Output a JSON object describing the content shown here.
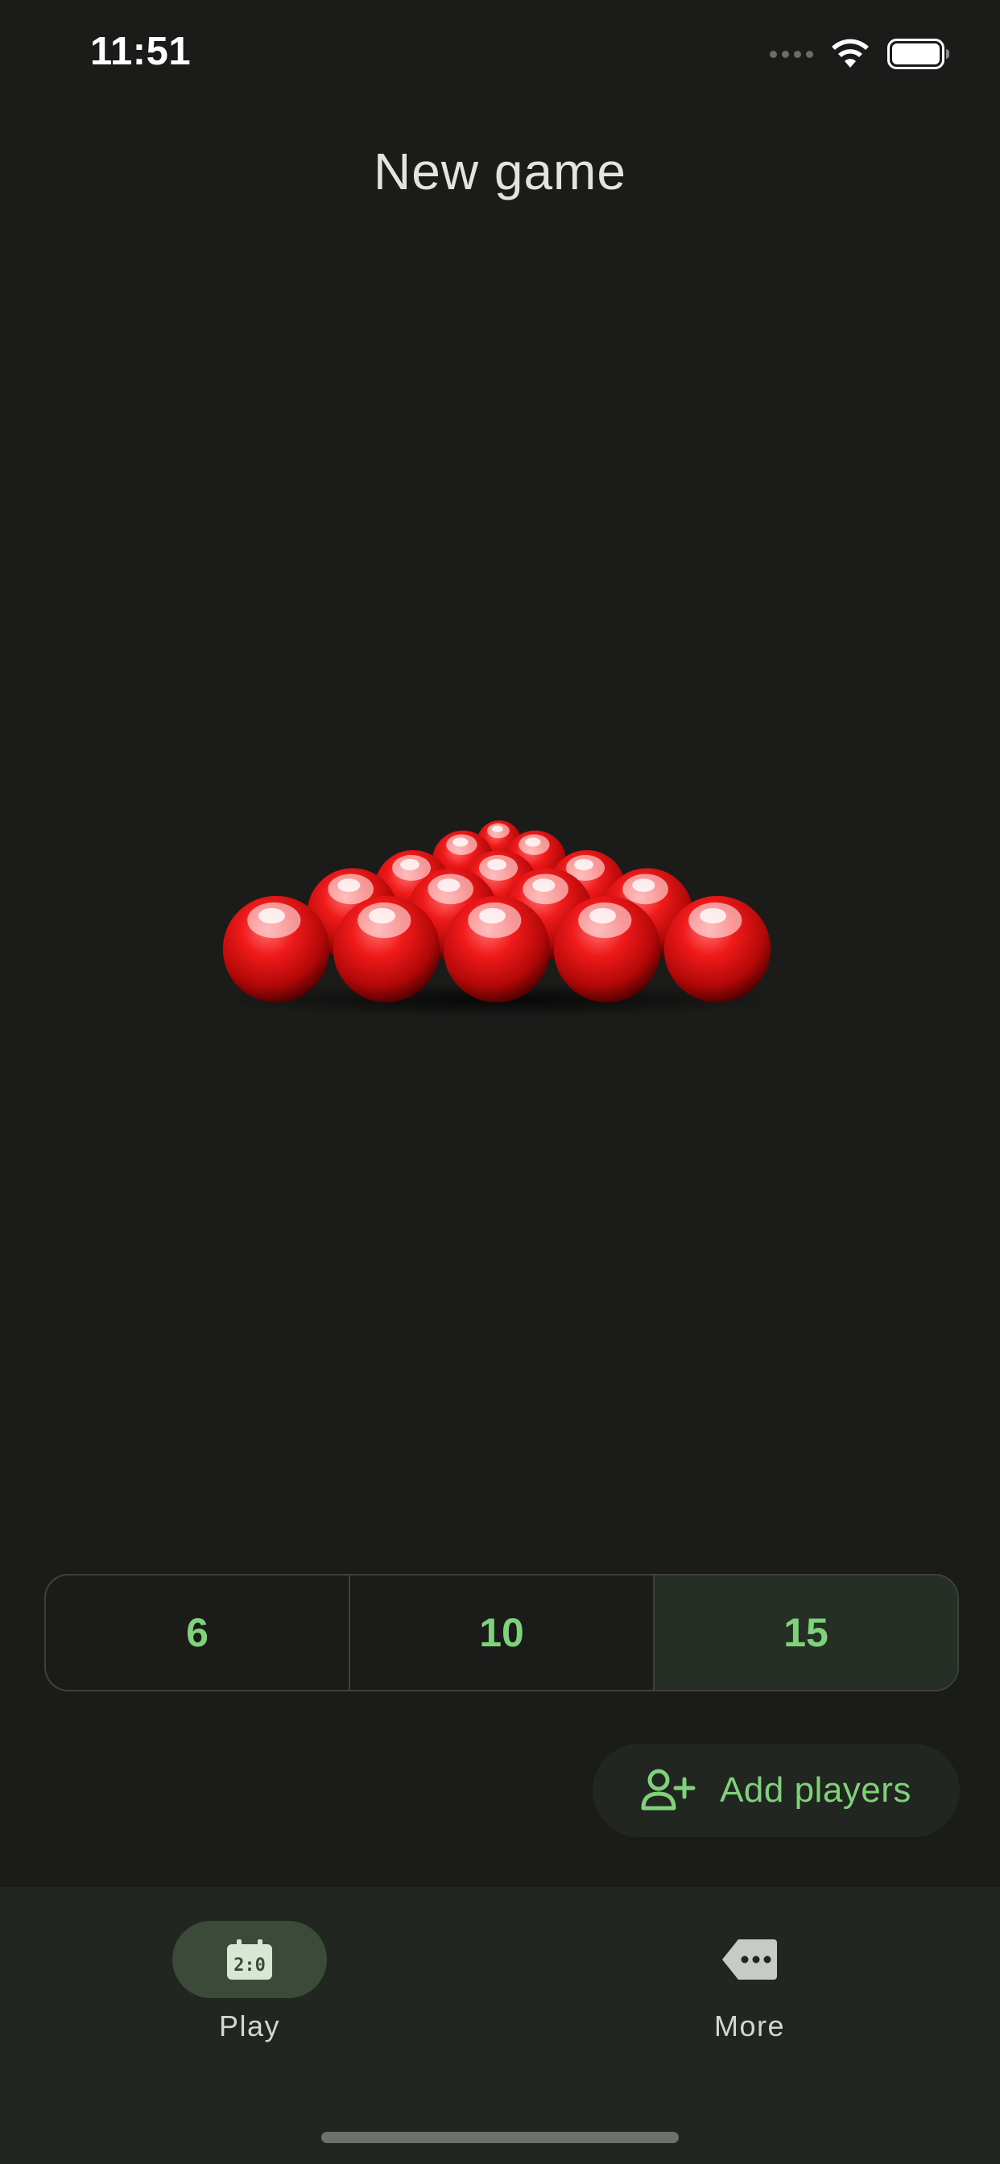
{
  "status_bar": {
    "time": "11:51",
    "icons": [
      "signal-icon",
      "wifi-icon",
      "battery-icon"
    ]
  },
  "header": {
    "title": "New game"
  },
  "illustration": {
    "icon": "snooker-rack-illustration",
    "ball_color": "#d90d0d"
  },
  "reds_selector": {
    "options": [
      "6",
      "10",
      "15"
    ],
    "selected": "15"
  },
  "actions": {
    "add_players_label": "Add players",
    "add_players_icon": "person-add-icon"
  },
  "bottom_nav": {
    "items": [
      {
        "label": "Play",
        "icon": "scoreboard-icon",
        "active": true
      },
      {
        "label": "More",
        "icon": "more-tag-icon",
        "active": false
      }
    ]
  },
  "colors": {
    "background": "#1b1c1a",
    "accent": "#7fd27a",
    "selected_segment": "#262f26",
    "nav_background": "#212720",
    "nav_active_pill": "#3c4a3a"
  }
}
